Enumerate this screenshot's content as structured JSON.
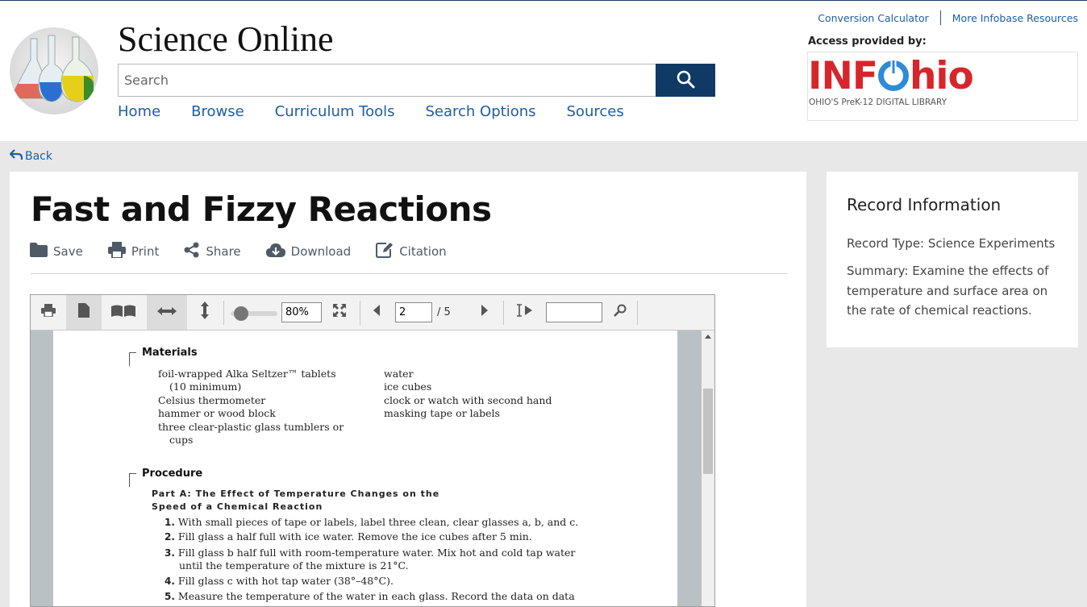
{
  "header": {
    "site_title": "Science Online",
    "search_placeholder": "Search",
    "nav": [
      "Home",
      "Browse",
      "Curriculum Tools",
      "Search Options",
      "Sources"
    ],
    "util_links": [
      "Conversion Calculator",
      "More Infobase Resources"
    ],
    "access_label": "Access provided by:",
    "provider_logo_word": "INFOhio",
    "provider_logo_sub": "OHIO'S PreK-12 DIGITAL LIBRARY"
  },
  "back_label": "Back",
  "document": {
    "title": "Fast and Fizzy Reactions",
    "actions": [
      "Save",
      "Print",
      "Share",
      "Download",
      "Citation"
    ]
  },
  "viewer": {
    "zoom": "80%",
    "page": "2",
    "page_total": "/ 5",
    "zoom_level": 0.2,
    "page_content": {
      "materials_heading": "Materials",
      "materials_left": [
        "foil-wrapped Alka Seltzer™ tablets",
        "(10 minimum)",
        "Celsius thermometer",
        "hammer or wood block",
        "three clear-plastic glass tumblers or",
        "cups"
      ],
      "materials_right": [
        "water",
        "ice cubes",
        "clock or watch with second hand",
        "masking tape or labels"
      ],
      "procedure_heading": "Procedure",
      "part_a_line1": "Part A: The Effect of Temperature Changes on the",
      "part_a_line2": "Speed of a Chemical Reaction",
      "steps": [
        {
          "n": "1.",
          "lines": [
            "With small pieces of tape or labels, label three clean, clear glasses a, b, and c."
          ]
        },
        {
          "n": "2.",
          "lines": [
            "Fill glass a half full with ice water. Remove the ice cubes after 5 min."
          ]
        },
        {
          "n": "3.",
          "lines": [
            "Fill glass b half full with room-temperature water. Mix hot and cold tap water",
            "until the temperature of the mixture is 21°C."
          ]
        },
        {
          "n": "4.",
          "lines": [
            "Fill glass c with hot tap water (38°–48°C)."
          ]
        },
        {
          "n": "5.",
          "lines": [
            "Measure the temperature of the water in each glass. Record the data on data"
          ]
        }
      ]
    }
  },
  "record_info": {
    "title": "Record Information",
    "type": "Record Type: Science Experiments",
    "summary": "Summary: Examine the effects of temperature and surface area on the rate of chemical reactions."
  },
  "colors": {
    "link_blue": "#1d5ea3",
    "search_button": "#0f3a65",
    "infohio_red": "#d7262b",
    "page_background": "#e8e8e8"
  },
  "icons": [
    "search-icon",
    "back-arrow-icon",
    "folder-icon",
    "print-icon",
    "share-icon",
    "cloud-download-icon",
    "edit-icon",
    "printer-icon",
    "single-page-icon",
    "two-page-icon",
    "fit-width-icon",
    "fit-height-icon",
    "fullscreen-icon",
    "prev-page-icon",
    "next-page-icon",
    "text-select-icon",
    "search-icon"
  ]
}
